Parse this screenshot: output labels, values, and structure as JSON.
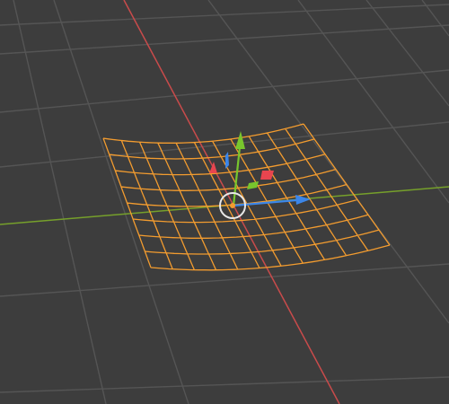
{
  "viewport": {
    "mode": "3d-viewport",
    "background_color": "#3d3d3d",
    "grid_color": "#555555",
    "x_axis_color": "#c94b4b",
    "y_axis_color": "#76a02b"
  },
  "selected_object": {
    "type": "mesh-grid-plane",
    "wire_color": "#f39c2f",
    "rows": 8,
    "cols": 11
  },
  "gizmo": {
    "type": "transform",
    "x_color": "#3c86e8",
    "y_color": "#78c62d",
    "z_color": "#e8454f",
    "pivot_ring_color": "#e8e8e8",
    "origin_color": "#f39c2f"
  }
}
